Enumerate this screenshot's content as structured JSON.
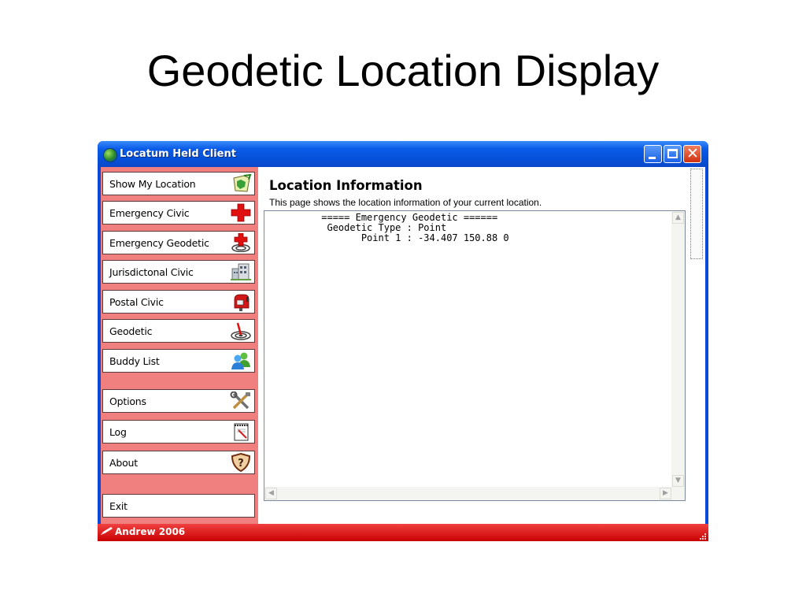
{
  "slide": {
    "title": "Geodetic Location Display"
  },
  "window": {
    "title": "Locatum Held Client",
    "controls": {
      "minimize": "minimize",
      "maximize": "maximize",
      "close": "close"
    }
  },
  "sidebar": {
    "items": [
      {
        "label": "Show My Location",
        "icon": "map-icon"
      },
      {
        "label": "Emergency Civic",
        "icon": "red-cross-icon"
      },
      {
        "label": "Emergency Geodetic",
        "icon": "red-cross-target-icon"
      },
      {
        "label": "Jurisdictonal Civic",
        "icon": "building-icon"
      },
      {
        "label": "Postal Civic",
        "icon": "mailbox-icon"
      },
      {
        "label": "Geodetic",
        "icon": "target-pin-icon"
      },
      {
        "label": "Buddy List",
        "icon": "buddies-icon"
      },
      {
        "label": "Options",
        "icon": "tools-icon"
      },
      {
        "label": "Log",
        "icon": "notepad-icon"
      },
      {
        "label": "About",
        "icon": "help-shield-icon"
      },
      {
        "label": "Exit",
        "icon": ""
      }
    ]
  },
  "content": {
    "title": "Location Information",
    "description": "This page shows the location information of your current location.",
    "text_lines": [
      "          ===== Emergency Geodetic ======",
      "           Geodetic Type : Point",
      "                 Point 1 : -34.407 150.88 0"
    ]
  },
  "status": {
    "text": "Andrew 2006"
  },
  "colors": {
    "titlebar": "#0a5ce8",
    "sidebar": "#f08080",
    "statusbar": "#d81010"
  }
}
